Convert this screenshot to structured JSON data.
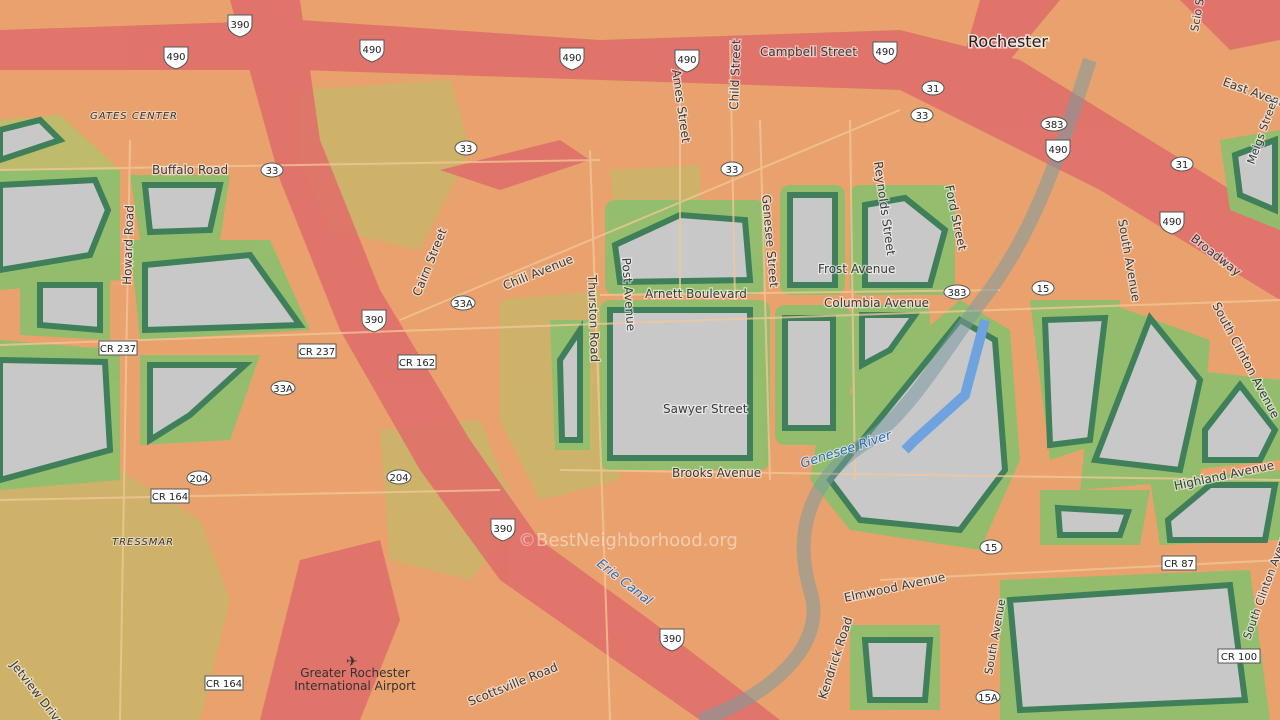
{
  "city": "Rochester",
  "watermark": "©BestNeighborhood.org",
  "airport": "Greater Rochester International Airport",
  "areas": [
    "GATES CENTER",
    "TRESSMAR"
  ],
  "water": {
    "river": "Genesee River",
    "canal": "Erie Canal"
  },
  "streets": {
    "campbell": "Campbell Street",
    "ames": "Ames Street",
    "child": "Child Street",
    "buffalo": "Buffalo Road",
    "howard": "Howard Road",
    "cairn": "Cairn Street",
    "chili": "Chili Avenue",
    "thurston": "Thurston Road",
    "post": "Post Avenue",
    "genesee": "Genesee Street",
    "reynolds": "Reynolds Street",
    "ford": "Ford Street",
    "frost": "Frost Avenue",
    "arnett": "Arnett Boulevard",
    "columbia": "Columbia Avenue",
    "sawyer": "Sawyer Street",
    "brooks": "Brooks Avenue",
    "south_ave": "South Avenue",
    "south_clinton": "South Clinton Avenue",
    "broadway": "Broadway",
    "east_ave": "East Avenue",
    "highland": "Highland Avenue",
    "elmwood": "Elmwood Avenue",
    "kendrick": "Kendrick Road",
    "scottsville": "Scottsville Road",
    "jetview": "Jetview Drive",
    "meigs": "Meigs Street",
    "scio": "Scio Street"
  },
  "shields": {
    "i390": "390",
    "i490": "490",
    "r33": "33",
    "r33a": "33A",
    "r31": "31",
    "r383": "383",
    "r15": "15",
    "r15a": "15A",
    "r204": "204",
    "cr237": "CR 237",
    "cr162": "CR 162",
    "cr164": "CR 164",
    "cr87": "CR 87",
    "cr100": "CR 100"
  }
}
